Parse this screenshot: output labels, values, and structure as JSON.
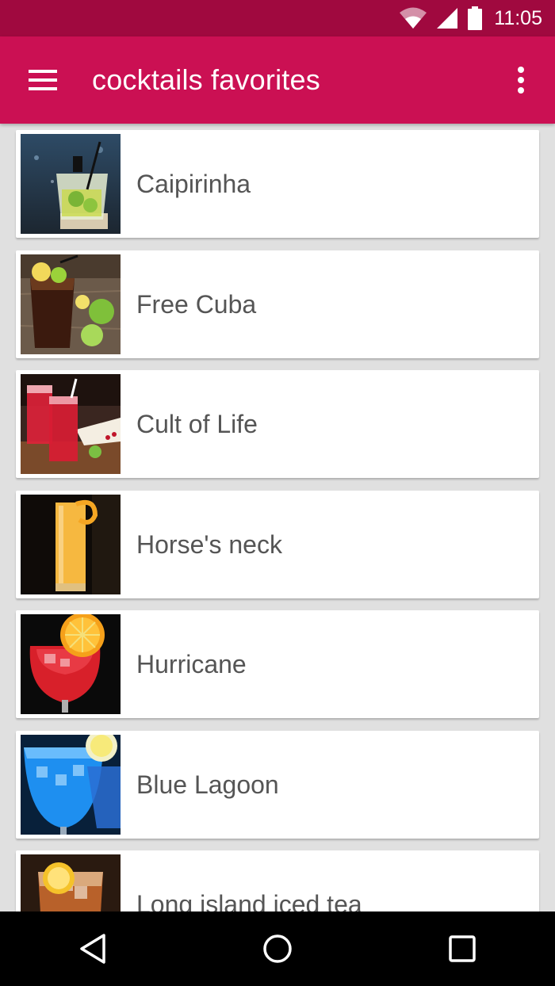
{
  "status_bar": {
    "time": "11:05",
    "icons": [
      "wifi-icon",
      "signal-icon",
      "battery-icon"
    ]
  },
  "toolbar": {
    "title": "cocktails favorites",
    "menu_icon": "hamburger-menu-icon",
    "overflow_icon": "more-vert-icon"
  },
  "colors": {
    "status_bar": "#a0093f",
    "toolbar": "#cb1053",
    "background": "#e0e0e0",
    "card": "#ffffff",
    "label_text": "#555555"
  },
  "cocktails": [
    {
      "name": "Caipirinha"
    },
    {
      "name": "Free Cuba"
    },
    {
      "name": "Cult of Life"
    },
    {
      "name": "Horse's neck"
    },
    {
      "name": "Hurricane"
    },
    {
      "name": "Blue Lagoon"
    },
    {
      "name": "Long island iced tea"
    }
  ],
  "nav_bar": {
    "buttons": [
      "back-icon",
      "home-icon",
      "recents-icon"
    ]
  }
}
